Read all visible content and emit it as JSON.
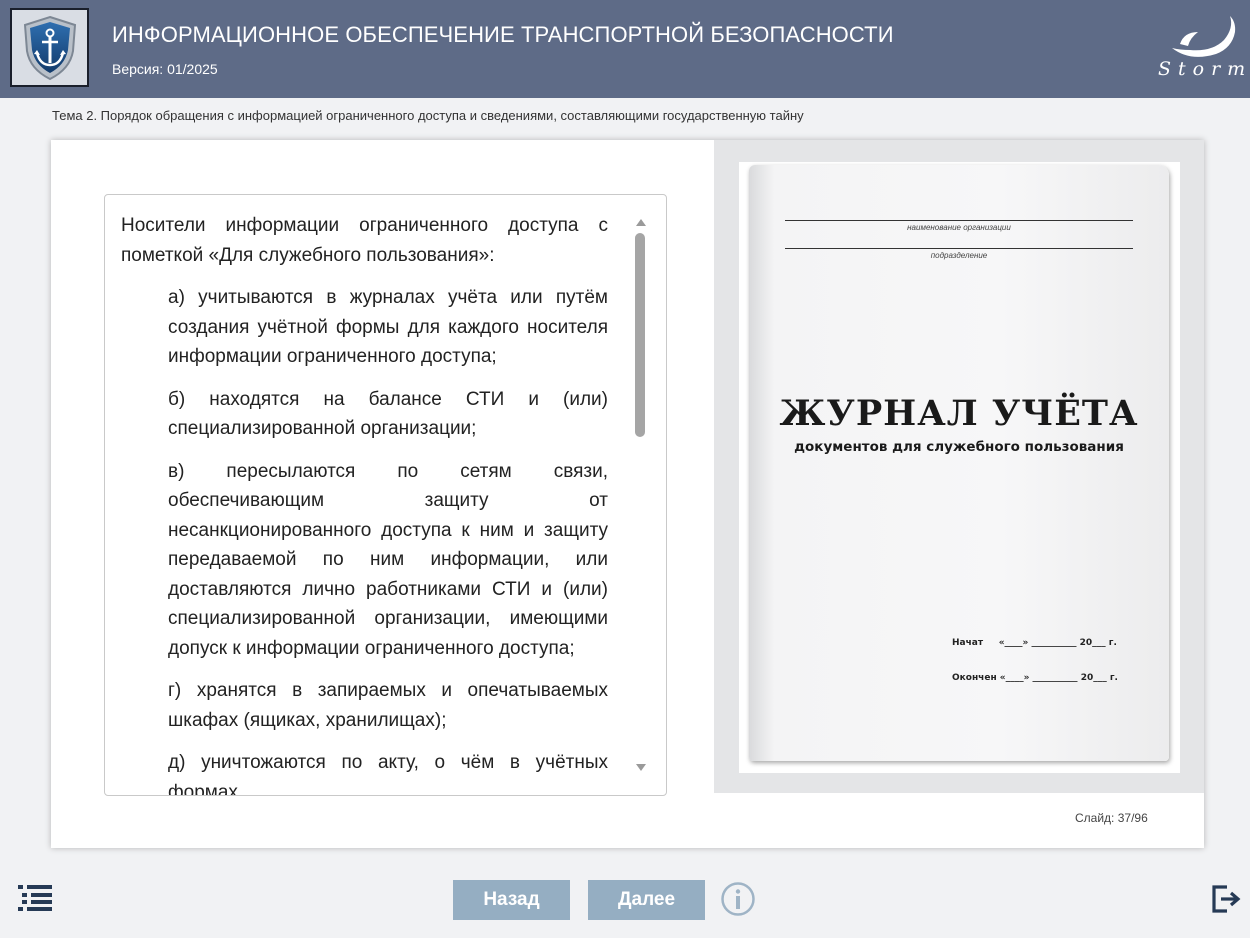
{
  "header": {
    "title": "ИНФОРМАЦИОННОЕ ОБЕСПЕЧЕНИЕ ТРАНСПОРТНОЙ БЕЗОПАСНОСТИ",
    "version": "Версия: 01/2025",
    "brand": "Storm"
  },
  "topic": "Тема 2. Порядок обращения с информацией ограниченного доступа и сведениями, составляющими государственную тайну",
  "content": {
    "intro": "Носители информации ограниченного доступа с пометкой «Для служебного пользования»:",
    "items": [
      "а) учитываются в журналах учёта или путём создания учётной формы для каждого носителя информации ограниченного доступа;",
      "б) находятся на балансе СТИ и (или) специализированной организации;",
      "в) пересылаются по сетям связи, обеспечивающим защиту от несанкционированного доступа к ним и защиту передаваемой по ним информации, или доставляются лично работниками СТИ и (или) специализированной организации, имеющими допуск к информации ограниченного доступа;",
      "г) хранятся в запираемых и опечатываемых шкафах (ящиках, хранилищах);",
      "д) уничтожаются по акту, о чём в учётных формах"
    ]
  },
  "journal": {
    "org_caption": "наименование организации",
    "dept_caption": "подразделение",
    "title": "ЖУРНАЛ УЧЁТА",
    "subtitle": "документов для служебного пользования",
    "started": "Начат     «____» __________ 20___ г.",
    "finished": "Окончен «____» __________ 20___ г."
  },
  "slide": {
    "counter": "Слайд:  37/96"
  },
  "footer": {
    "back_label": "Назад",
    "next_label": "Далее"
  },
  "icons": {
    "menu": "menu-list-icon",
    "info": "info-icon",
    "exit": "exit-icon",
    "logo": "anchor-shield-icon"
  },
  "colors": {
    "header_bg": "#5e6b87",
    "button_bg": "#95aec2",
    "page_bg": "#f1f2f4"
  }
}
